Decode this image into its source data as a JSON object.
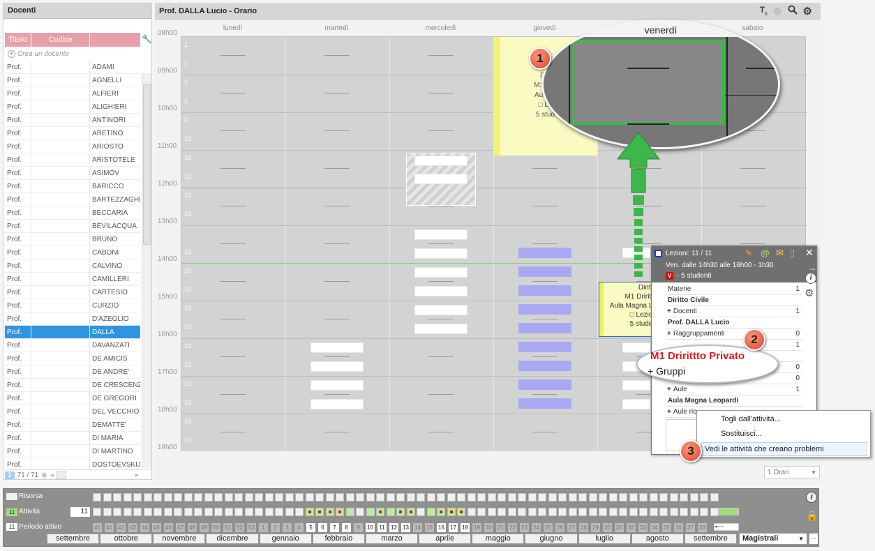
{
  "left_panel": {
    "title": "Docenti",
    "col_titolo": "Titolo",
    "col_codice": "Codice",
    "create_label": "Crea un docente",
    "rows": [
      {
        "t": "Prof.",
        "n": "ADAMI"
      },
      {
        "t": "Prof.",
        "n": "AGNELLI"
      },
      {
        "t": "Prof.",
        "n": "ALFIERI"
      },
      {
        "t": "Prof.",
        "n": "ALIGHIERI"
      },
      {
        "t": "Prof.",
        "n": "ANTINORI"
      },
      {
        "t": "Prof.",
        "n": "ARETINO"
      },
      {
        "t": "Prof.",
        "n": "ARIOSTO"
      },
      {
        "t": "Prof.",
        "n": "ARISTOTELE"
      },
      {
        "t": "Prof.",
        "n": "ASIMOV"
      },
      {
        "t": "Prof.",
        "n": "BARICCO"
      },
      {
        "t": "Prof.",
        "n": "BARTEZZAGHI"
      },
      {
        "t": "Prof.",
        "n": "BECCARIA"
      },
      {
        "t": "Prof.",
        "n": "BEVILACQUA"
      },
      {
        "t": "Prof.",
        "n": "BRUNO"
      },
      {
        "t": "Prof.",
        "n": "CABONI"
      },
      {
        "t": "Prof.",
        "n": "CALVINO"
      },
      {
        "t": "Prof.",
        "n": "CAMILLERI"
      },
      {
        "t": "Prof.",
        "n": "CARTESIO"
      },
      {
        "t": "Prof.",
        "n": "CURZIO"
      },
      {
        "t": "Prof.",
        "n": "D'AZEGLIO"
      },
      {
        "t": "Prof.",
        "n": "DALLA",
        "sel": true
      },
      {
        "t": "Prof.",
        "n": "DAVANZATI"
      },
      {
        "t": "Prof.",
        "n": "DE AMICIS"
      },
      {
        "t": "Prof.",
        "n": "DE ANDRE'"
      },
      {
        "t": "Prof.",
        "n": "DE CRESCENZO"
      },
      {
        "t": "Prof.",
        "n": "DE GREGORI"
      },
      {
        "t": "Prof.",
        "n": "DEL VECCHIO"
      },
      {
        "t": "Prof.",
        "n": "DEMATTE'"
      },
      {
        "t": "Prof.",
        "n": "DI MARIA"
      },
      {
        "t": "Prof.",
        "n": "DI MARTINO"
      },
      {
        "t": "Prof.",
        "n": "DOSTOEVSKIJ"
      }
    ],
    "footer_sel": "1",
    "footer_count": "71 / 71"
  },
  "timetable": {
    "title": "Prof. DALLA Lucio - Orario",
    "days": [
      "lunedì",
      "martedì",
      "mercoledì",
      "giovedì",
      "venerdì",
      "sabato"
    ],
    "hours": [
      "08h00",
      "09h00",
      "10h00",
      "11h00",
      "12h00",
      "13h00",
      "14h00",
      "15h00",
      "16h00",
      "17h00",
      "18h00",
      "19h00"
    ],
    "slot_labels": [
      "1",
      "1",
      "1",
      "1",
      "1",
      "10",
      "10",
      "10",
      "10",
      "10",
      "",
      "10",
      "10",
      "10",
      "10",
      "10",
      "10",
      "10",
      "10",
      "10",
      "10",
      "10"
    ],
    "thursday_lesson": [
      "Diri",
      "M1 Drir",
      "Aula M",
      "□ Le",
      "5 stud"
    ],
    "friday_lesson": [
      "Diritto",
      "M1 Dririttc",
      "Aula Magna Le",
      "□ Lezion",
      "5 studen"
    ],
    "orari_select": "1 Orari"
  },
  "magnifier": {
    "day": "venerdì"
  },
  "badges": [
    "1",
    "2",
    "3"
  ],
  "card": {
    "title": "Lezioni: 11 / 11",
    "when": "Ven. dalle 14h30 alle 16h00 - 1h30",
    "students": "- 5 studenti",
    "v_label": "V",
    "rows": [
      {
        "label": "Materie",
        "num": "1",
        "bold": false,
        "plus": false
      },
      {
        "label": "Diritto Civile",
        "num": "",
        "bold": true,
        "plus": false
      },
      {
        "label": "Docenti",
        "num": "1",
        "bold": false,
        "plus": true
      },
      {
        "label": "Prof. DALLA Lucio",
        "num": "",
        "bold": true,
        "plus": false
      },
      {
        "label": "Raggruppamenti",
        "num": "0",
        "bold": false,
        "plus": true
      },
      {
        "label": "",
        "num": "1",
        "bold": false,
        "plus": false
      },
      {
        "label": "",
        "num": "",
        "bold": false,
        "plus": false
      },
      {
        "label": "",
        "num": "0",
        "bold": false,
        "plus": false
      },
      {
        "label": "",
        "num": "0",
        "bold": false,
        "plus": false
      },
      {
        "label": "Aule",
        "num": "1",
        "bold": false,
        "plus": true
      },
      {
        "label": "Aula Magna Leopardi",
        "num": "",
        "bold": true,
        "plus": false
      },
      {
        "label": "Aule ric",
        "num": "",
        "bold": false,
        "plus": true
      }
    ]
  },
  "zoom_oval": {
    "subject": "M1 Dririttto Privato",
    "groups": "Gruppi"
  },
  "context_menu": {
    "item1": "Togli dall'attività...",
    "item2": "Sostituisci...",
    "item3": "Vedi le attività che creano problemi"
  },
  "bottom": {
    "risorsa": "Risorsa",
    "attivita_badge": "11",
    "attivita": "Attività",
    "attivita_count": "11",
    "periodo_badge": "11",
    "periodo": "Periodo attivo",
    "weeks": [
      "40",
      "41",
      "42",
      "43",
      "44",
      "45",
      "46",
      "47",
      "48",
      "49",
      "50",
      "51",
      "52",
      "53",
      "1",
      "2",
      "3",
      "4",
      "5",
      "6",
      "7",
      "8",
      "9",
      "10",
      "11",
      "12",
      "13",
      "14",
      "15",
      "16",
      "17",
      "18",
      "19",
      "20",
      "21",
      "22",
      "23",
      "24",
      "25",
      "26",
      "27",
      "28",
      "29",
      "30",
      "31",
      "32",
      "33",
      "34",
      "35",
      "36",
      "37",
      "38"
    ],
    "weeks_on": [
      "5",
      "6",
      "7",
      "8",
      "10",
      "11",
      "12",
      "13",
      "16",
      "17",
      "18"
    ],
    "months": [
      "settembre",
      "ottobre",
      "novembre",
      "dicembre",
      "gennaio",
      "febbraio",
      "marzo",
      "aprile",
      "maggio",
      "giugno",
      "luglio",
      "agosto",
      "settembre"
    ],
    "select": "Magistrali"
  },
  "colors": {
    "selected_row": "#2f95e0",
    "accent_green": "#3db64a",
    "badge_red": "#d9402a",
    "lesson_blue": "#a9a9f3"
  }
}
